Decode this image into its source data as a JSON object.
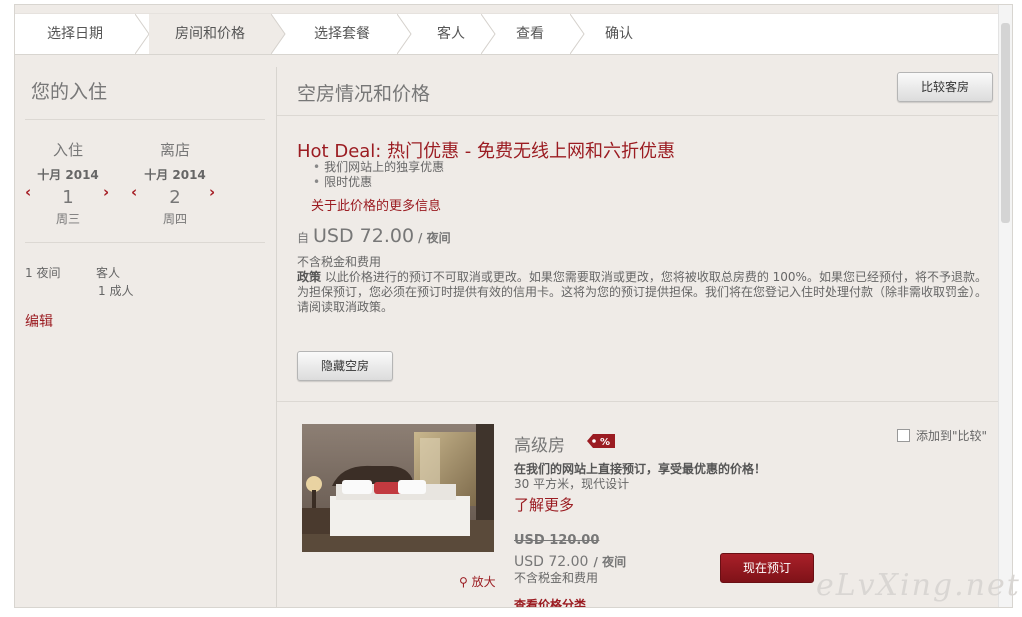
{
  "steps": [
    {
      "label": "选择日期"
    },
    {
      "label": "房间和价格"
    },
    {
      "label": "选择套餐"
    },
    {
      "label": "客人"
    },
    {
      "label": "查看"
    },
    {
      "label": "确认"
    }
  ],
  "active_step": 1,
  "sidebar": {
    "title": "您的入住",
    "checkin": {
      "label": "入住",
      "month": "十月 2014",
      "day": "1",
      "weekday": "周三"
    },
    "checkout": {
      "label": "离店",
      "month": "十月 2014",
      "day": "2",
      "weekday": "周四"
    },
    "nights": "1 夜间",
    "guests_label": "客人",
    "guests_value": "1 成人",
    "edit": "编辑"
  },
  "main": {
    "title": "空房情况和价格",
    "compare_rooms_button": "比较客房",
    "deal": {
      "prefix": "Hot Deal:",
      "title": " 热门优惠 - 免费无线上网和六折优惠",
      "bullets": [
        "我们网站上的独享优惠",
        "限时优惠"
      ],
      "more_info": "关于此价格的更多信息",
      "from_label": "自",
      "price": "USD 72.00",
      "per_night": "/ 夜间",
      "tax_note": "不含税金和费用",
      "policy_label": "政策",
      "policy_text": " 以此价格进行的预订不可取消或更改。如果您需要取消或更改，您将被收取总房费的 100%。如果您已经预付，将不予退款。为担保预订，您必须在预订时提供有效的信用卡。这将为您的预订提供担保。我们将在您登记入住时处理付款（除非需收取罚金）。请阅读取消政策。",
      "hide_rooms_button": "隐藏空房"
    },
    "room": {
      "name": "高级房",
      "badge": "%",
      "compare_label": "添加到\"比较\"",
      "promo": "在我们的网站上直接预订，享受最优惠的价格！",
      "size": "30 平方米，现代设计",
      "learn_more": "了解更多",
      "zoom": "放大",
      "old_price": "USD 120.00",
      "price": "USD 72.00",
      "per_night": "/ 夜间",
      "tax_note": "不含税金和费用",
      "book_button": "现在预订",
      "rate_breakdown": "查看价格分类"
    }
  },
  "watermark": "eLvXing.net",
  "colors": {
    "accent": "#9b1c22",
    "panel": "#efebe7"
  }
}
